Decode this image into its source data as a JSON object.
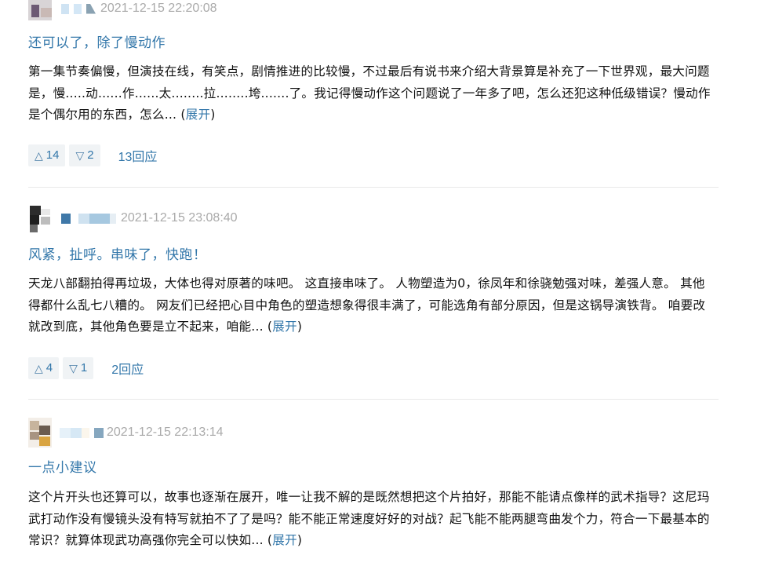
{
  "reviews": [
    {
      "timestamp": "2021-12-15 22:20:08",
      "title": "还可以了，除了慢动作",
      "body": "第一集节奏偏慢，但演技在线，有笑点，剧情推进的比较慢，不过最后有说书来介绍大背景算是补充了一下世界观，最大问题是，慢.....动......作......太........拉........垮.......了。我记得慢动作这个问题说了一年多了吧，怎么还犯这种低级错误？慢动作是个偶尔用的东西，怎么...",
      "expand_label": "展开",
      "up_count": "14",
      "down_count": "2",
      "replies_label": "13回应"
    },
    {
      "timestamp": "2021-12-15 23:08:40",
      "title": "风紧，扯呼。串味了，快跑！",
      "body": "天龙八部翻拍得再垃圾，大体也得对原著的味吧。 这直接串味了。 人物塑造为0，徐凤年和徐骁勉强对味，差强人意。 其他得都什么乱七八糟的。 网友们已经把心目中角色的塑造想象得很丰满了，可能选角有部分原因，但是这锅导演铁背。 咱要改就改到底，其他角色要是立不起来，咱能...",
      "expand_label": "展开",
      "up_count": "4",
      "down_count": "1",
      "replies_label": "2回应"
    },
    {
      "timestamp": "2021-12-15 22:13:14",
      "title": "一点小建议",
      "body": "这个片开头也还算可以，故事也逐渐在展开，唯一让我不解的是既然想把这个片拍好，那能不能请点像样的武术指导？这尼玛武打动作没有慢镜头没有特写就拍不了了是吗？能不能正常速度好好的对战？起飞能不能两腿弯曲发个力，符合一下最基本的常识？就算体现武功高强你完全可以快如...",
      "expand_label": "展开"
    }
  ],
  "icons": {
    "up": "triangle-up-icon",
    "down": "triangle-down-icon"
  },
  "colors": {
    "link": "#3377aa",
    "time": "#aaaaaa",
    "vote_bg": "#f0f3f5"
  }
}
